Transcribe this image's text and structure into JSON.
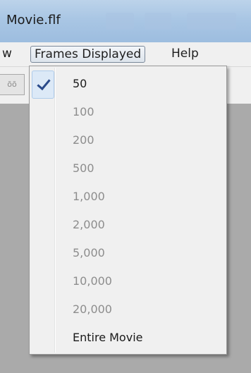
{
  "window": {
    "title": "Movie.flf"
  },
  "menubar": {
    "partial_item": "w",
    "open_menu": "Frames Displayed",
    "help": "Help"
  },
  "dropdown": {
    "checked_index": 0,
    "options": [
      {
        "label": "50",
        "enabled": true,
        "checked": true
      },
      {
        "label": "100",
        "enabled": false
      },
      {
        "label": "200",
        "enabled": false
      },
      {
        "label": "500",
        "enabled": false
      },
      {
        "label": "1,000",
        "enabled": false
      },
      {
        "label": "2,000",
        "enabled": false
      },
      {
        "label": "5,000",
        "enabled": false
      },
      {
        "label": "10,000",
        "enabled": false
      },
      {
        "label": "20,000",
        "enabled": false
      },
      {
        "label": "Entire Movie",
        "enabled": true
      }
    ]
  },
  "icons": {
    "check": "checkmark-icon"
  }
}
